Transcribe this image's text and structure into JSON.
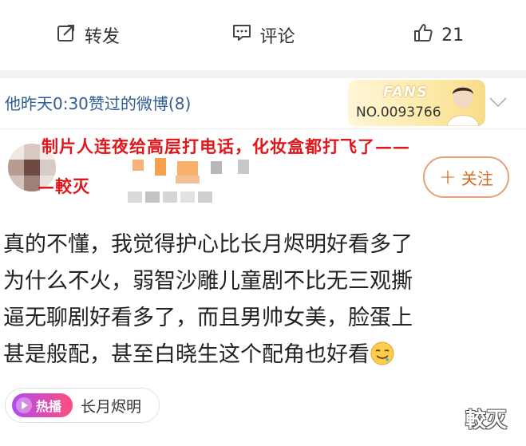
{
  "actions": {
    "repost_label": "转发",
    "comment_label": "评论",
    "like_count": "21"
  },
  "liked_header": {
    "text": "他昨天0:30赞过的微博(8)"
  },
  "fans_badge": {
    "title": "FANS",
    "number": "NO.0093766"
  },
  "overlay_caption": {
    "line1": "制片人连夜给高层打电话，化妆盒都打飞了——",
    "line2": "—較灭"
  },
  "follow_button": {
    "label": "关注"
  },
  "post": {
    "lines": [
      "真的不懂，我觉得护心比长月烬明好看多了",
      "为什么不火，弱智沙雕儿童剧不比无三观撕",
      "逼无聊剧好看多了，而且男帅女美，脸蛋上",
      "甚是般配，甚至白晓生这个配角也好看"
    ]
  },
  "topic": {
    "hot_label": "热播",
    "name": "长月烬明"
  },
  "watermark": "較灭",
  "colors": {
    "link_blue": "#2f5d92",
    "follow_orange": "#d2691e",
    "overlay_red": "#e0161a"
  }
}
